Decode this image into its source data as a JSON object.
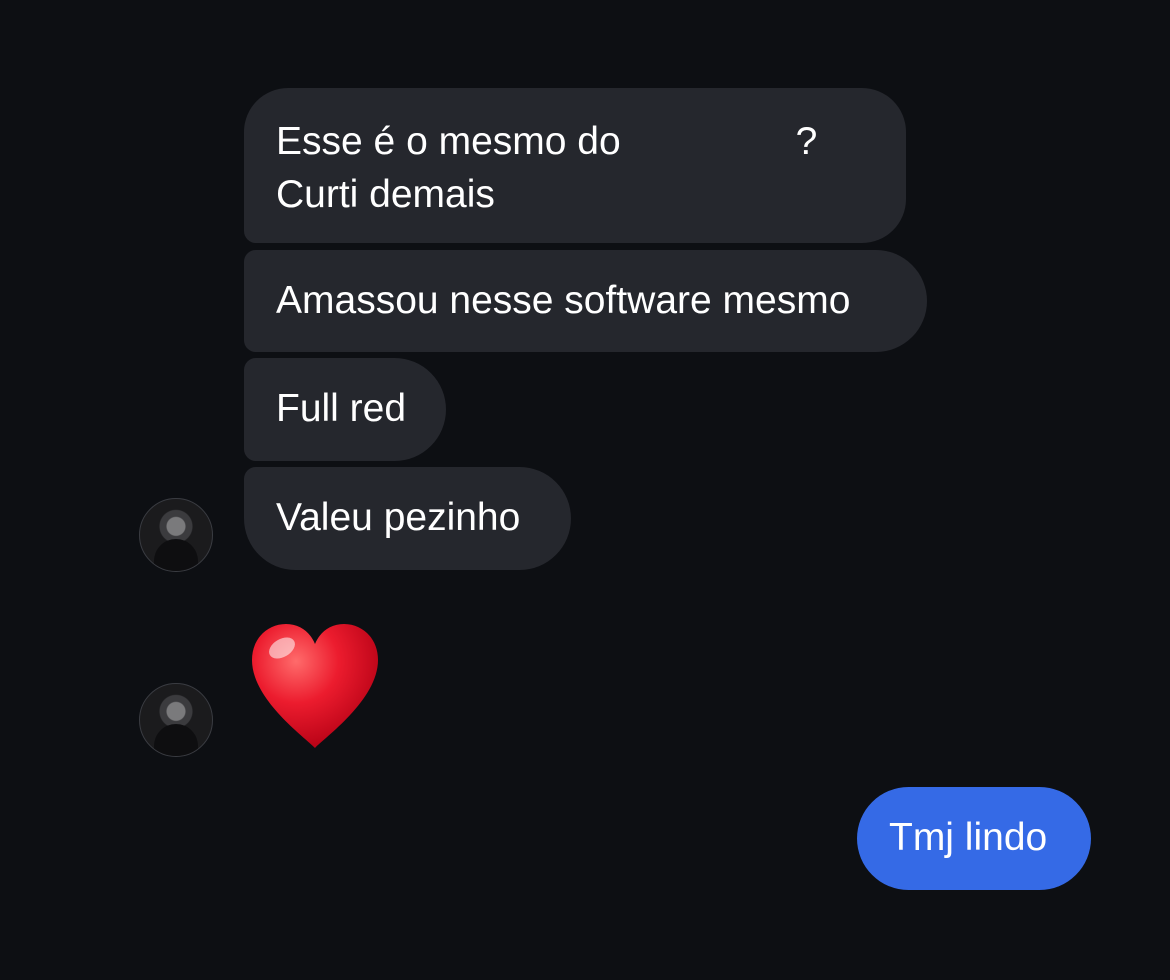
{
  "messages": {
    "incoming": [
      {
        "line1": "Esse é o mesmo do",
        "line1_end": "?",
        "line2": "Curti demais"
      },
      {
        "text": "Amassou nesse software mesmo"
      },
      {
        "text": "Full red"
      },
      {
        "text": "Valeu pezinho"
      }
    ],
    "reaction_emoji": "red-heart",
    "outgoing": [
      {
        "text": "Tmj lindo"
      }
    ]
  },
  "colors": {
    "background": "#0d0f13",
    "incoming_bubble": "#25272d",
    "outgoing_bubble": "#356ae6",
    "text": "#ffffff",
    "heart": "#e0142a"
  },
  "icons": {
    "avatar": "contact-avatar",
    "heart": "heart-emoji"
  }
}
